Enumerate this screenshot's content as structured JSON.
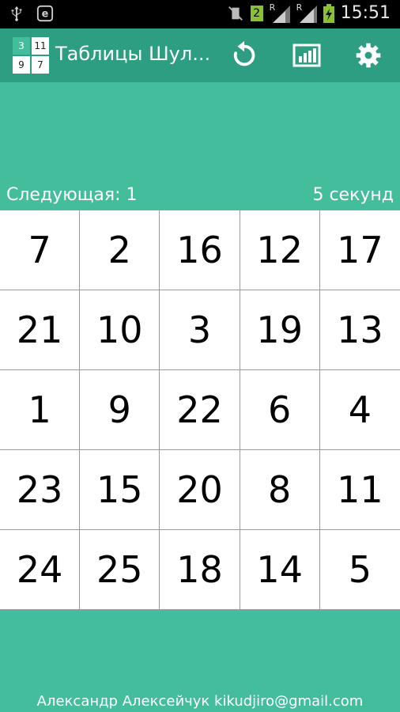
{
  "status_bar": {
    "time": "15:51",
    "sim_badge": "2",
    "roaming_label_1": "R",
    "roaming_label_2": "R"
  },
  "app_bar": {
    "logo_cells": [
      "3",
      "11",
      "9",
      "7"
    ],
    "title": "Таблицы Шул..."
  },
  "info": {
    "next_label": "Следующая: 1",
    "timer_label": "5 секунд"
  },
  "grid": {
    "cells": [
      "7",
      "2",
      "16",
      "12",
      "17",
      "21",
      "10",
      "3",
      "19",
      "13",
      "1",
      "9",
      "22",
      "6",
      "4",
      "23",
      "15",
      "20",
      "8",
      "11",
      "24",
      "25",
      "18",
      "14",
      "5"
    ]
  },
  "footer": {
    "credit": "Александр Алексейчук kikudjiro@gmail.com"
  },
  "colors": {
    "background": "#44bd9d",
    "app_bar": "#2e9e82",
    "status_bar": "#000000"
  }
}
